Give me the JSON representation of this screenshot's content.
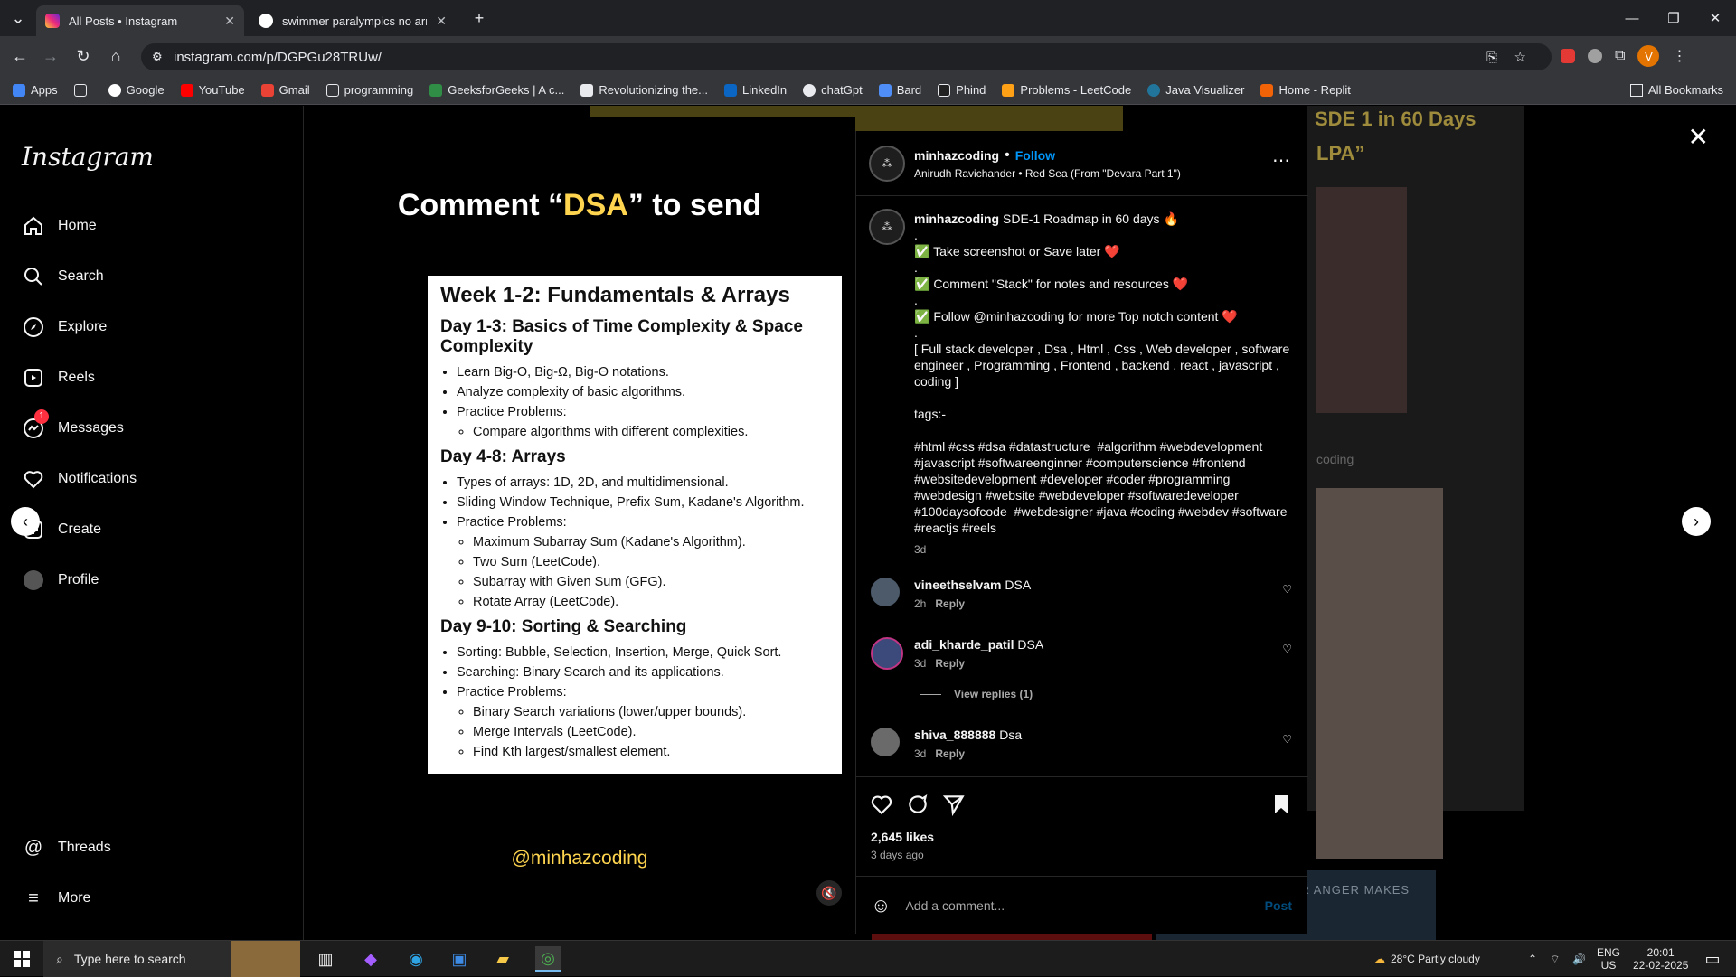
{
  "browser": {
    "tabs": [
      {
        "title": "All Posts • Instagram",
        "active": true
      },
      {
        "title": "swimmer paralympics no arms",
        "active": false
      }
    ],
    "url": "instagram.com/p/DGPGu28TRUw/",
    "bookmarks": [
      "Apps",
      "Google",
      "YouTube",
      "Gmail",
      "programming",
      "GeeksforGeeks | A c...",
      "Revolutionizing the...",
      "LinkedIn",
      "chatGpt",
      "Bard",
      "Phind",
      "Problems - LeetCode",
      "Java Visualizer",
      "Home - Replit"
    ],
    "all_bookmarks": "All Bookmarks",
    "profile_initial": "V"
  },
  "sidebar": {
    "logo": "Instagram",
    "items": [
      {
        "label": "Home",
        "icon": "home-icon"
      },
      {
        "label": "Search",
        "icon": "search-icon"
      },
      {
        "label": "Explore",
        "icon": "explore-icon"
      },
      {
        "label": "Reels",
        "icon": "reels-icon"
      },
      {
        "label": "Messages",
        "icon": "messages-icon",
        "badge": "1"
      },
      {
        "label": "Notifications",
        "icon": "heart-icon"
      },
      {
        "label": "Create",
        "icon": "create-icon"
      },
      {
        "label": "Profile",
        "icon": "avatar"
      }
    ],
    "threads": "Threads",
    "more": "More"
  },
  "media": {
    "title_pre": "Comment “",
    "title_hl": "DSA",
    "title_post": "” to send",
    "doc": {
      "h1": "Week 1-2: Fundamentals & Arrays",
      "s1_title": "Day 1-3: Basics of Time Complexity & Space Complexity",
      "s1_items": [
        "Learn Big-O, Big-Ω, Big-Θ notations.",
        "Analyze complexity of basic algorithms.",
        "Practice Problems:"
      ],
      "s1_sub": [
        "Compare algorithms with different complexities."
      ],
      "s2_title": "Day 4-8: Arrays",
      "s2_items": [
        "Types of arrays: 1D, 2D, and multidimensional.",
        "Sliding Window Technique, Prefix Sum, Kadane's Algorithm.",
        "Practice Problems:"
      ],
      "s2_sub": [
        "Maximum Subarray Sum (Kadane's Algorithm).",
        "Two Sum (LeetCode).",
        "Subarray with Given Sum (GFG).",
        "Rotate Array (LeetCode)."
      ],
      "s3_title": "Day 9-10: Sorting & Searching",
      "s3_items": [
        "Sorting: Bubble, Selection, Insertion, Merge, Quick Sort.",
        "Searching: Binary Search and its applications.",
        "Practice Problems:"
      ],
      "s3_sub": [
        "Binary Search variations (lower/upper bounds).",
        "Merge Intervals (LeetCode).",
        "Find Kth largest/smallest element."
      ]
    },
    "handle": "@minhazcoding"
  },
  "post": {
    "username": "minhazcoding",
    "follow": "Follow",
    "audio": "Anirudh Ravichander • Red Sea (From \"Devara Part 1\")",
    "caption": {
      "first": "SDE-1 Roadmap in 60 days 🔥",
      "lines": [
        ".",
        "✅ Take screenshot or Save later ❤️",
        ".",
        "✅ Comment \"Stack\" for notes and resources ❤️",
        ".",
        "✅ Follow @minhazcoding for more Top notch content ❤️",
        ".",
        "[ Full stack developer , Dsa , Html , Css , Web developer , software engineer , Programming , Frontend , backend , react , javascript , coding ]",
        "",
        "tags:-",
        "",
        "#html #css #dsa #datastructure  #algorithm #webdevelopment #javascript #softwareenginner #computerscience #frontend #websitedevelopment #developer #coder #programming #webdesign #website #webdeveloper #softwaredeveloper #100daysofcode  #webdesigner #java #coding #webdev #software #reactjs #reels"
      ],
      "time": "3d"
    },
    "comments": [
      {
        "user": "vineethselvam",
        "text": "DSA",
        "time": "2h",
        "reply": "Reply"
      },
      {
        "user": "adi_kharde_patil",
        "text": "DSA",
        "time": "3d",
        "reply": "Reply",
        "view_replies": "View replies (1)"
      },
      {
        "user": "shiva_888888",
        "text": "Dsa",
        "time": "3d",
        "reply": "Reply"
      }
    ],
    "likes": "2,645 likes",
    "posted": "3 days ago",
    "add_comment_placeholder": "Add a comment...",
    "post_label": "Post"
  },
  "background_posts": {
    "title1": "SDE 1 in 60 Days",
    "title2": "LPA”",
    "coding": "coding",
    "bottom_text": "CONTROLLING YOUR ANGER MAKES"
  },
  "taskbar": {
    "search_placeholder": "Type here to search",
    "weather": "28°C  Partly cloudy",
    "lang": "ENG",
    "region": "US",
    "time": "20:01",
    "date": "22-02-2025"
  },
  "colors": {
    "follow": "#0095f6",
    "accent_yellow": "#ffd54f",
    "badge": "#ff3040"
  }
}
